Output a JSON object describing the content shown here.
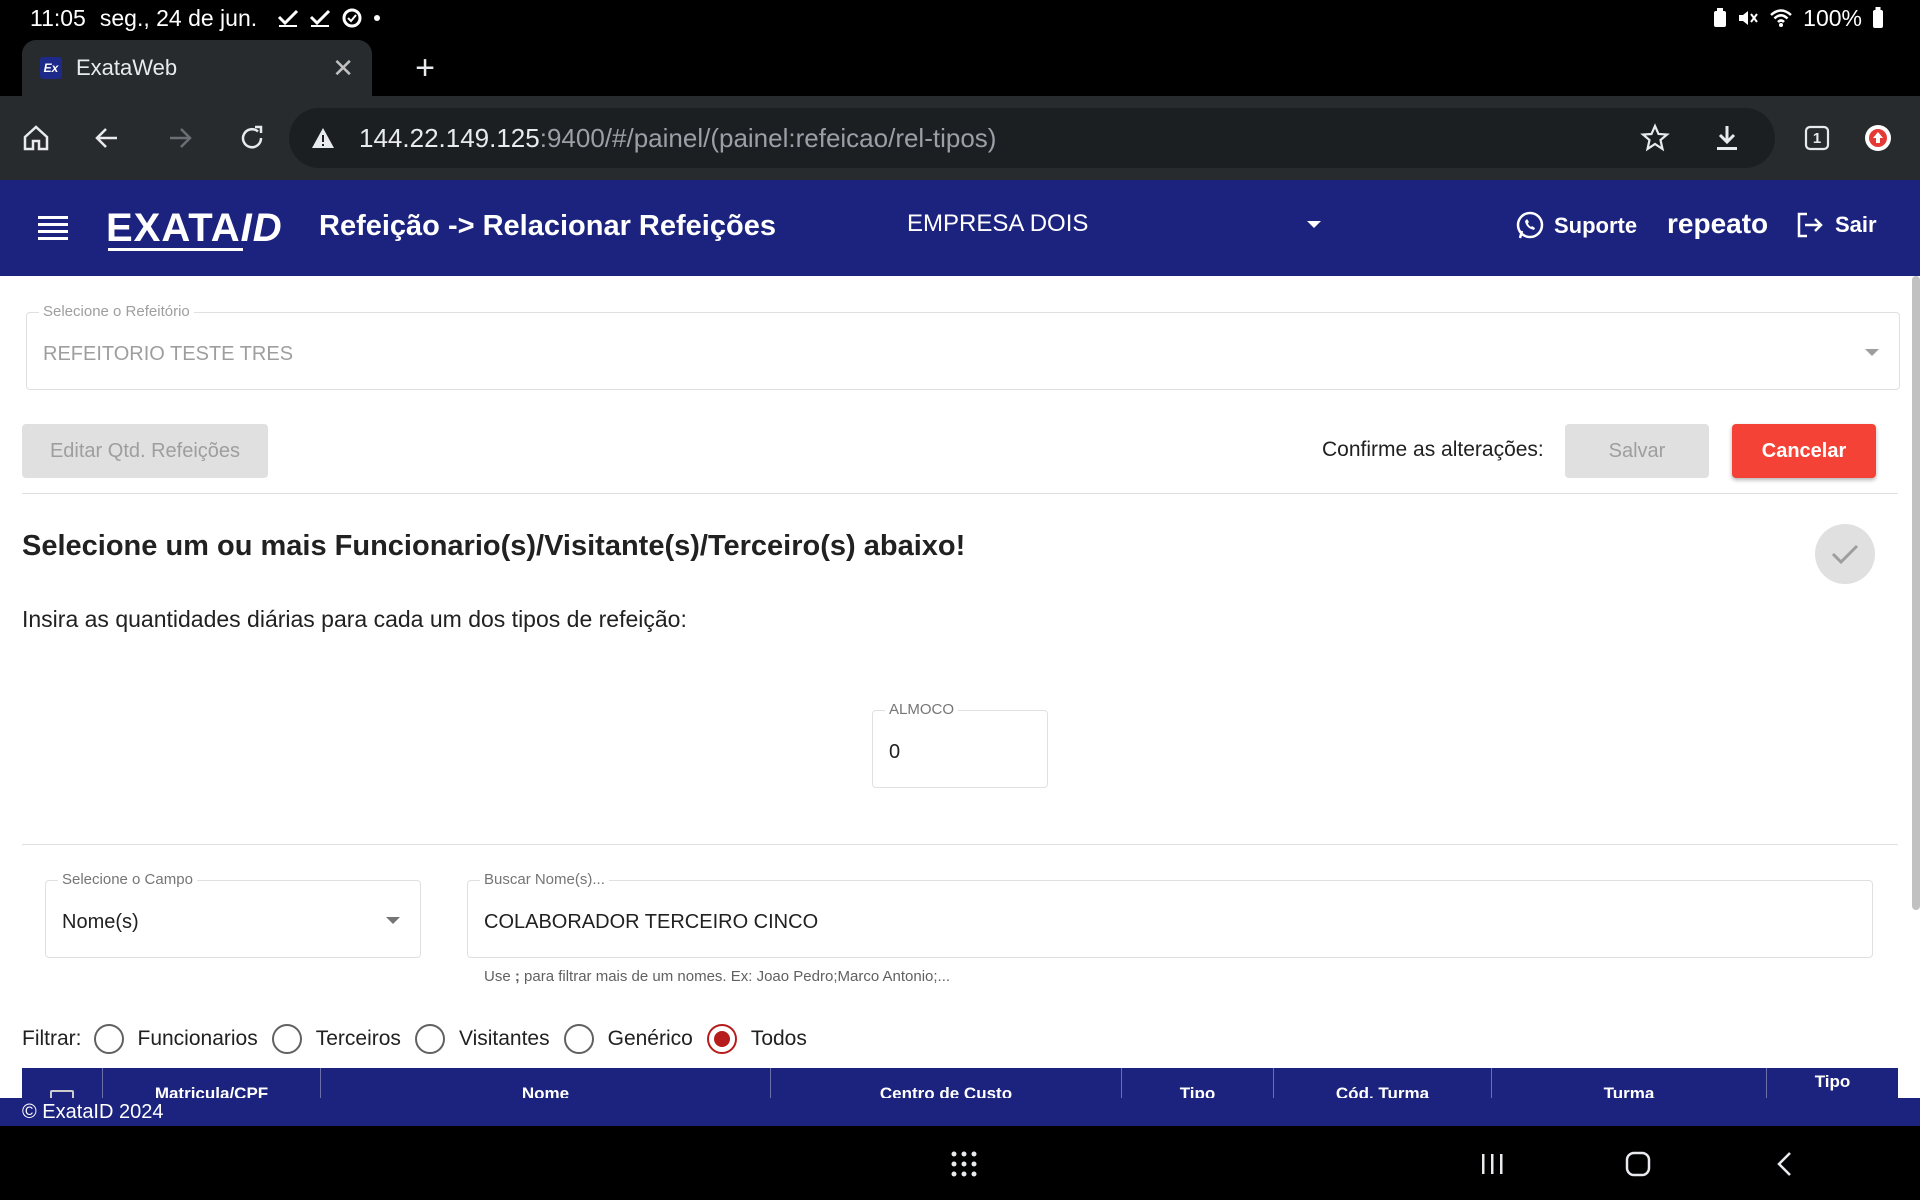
{
  "status_bar": {
    "time": "11:05",
    "date": "seg., 24 de jun.",
    "battery": "100%"
  },
  "browser": {
    "tab_title": "ExataWeb",
    "favicon_text": "Ex",
    "url_host": "144.22.149.125",
    "url_path": ":9400/#/painel/(painel:refeicao/rel-tipos)",
    "tab_count": "1"
  },
  "header": {
    "logo_text": "EXATA",
    "logo_suffix": "ID",
    "title": "Refeição -> Relacionar Refeições",
    "company": "EMPRESA DOIS",
    "support_label": "Suporte",
    "username": "repeato",
    "logout_label": "Sair"
  },
  "form": {
    "refeitorio_label": "Selecione o Refeitório",
    "refeitorio_value": "REFEITORIO TESTE TRES",
    "edit_button": "Editar Qtd. Refeições",
    "confirm_label": "Confirme as alterações:",
    "save_button": "Salvar",
    "cancel_button": "Cancelar",
    "heading": "Selecione um ou mais Funcionario(s)/Visitante(s)/Terceiro(s) abaixo!",
    "subheading": "Insira as quantidades diárias para cada um dos tipos de refeição:",
    "almoco_label": "ALMOCO",
    "almoco_value": "0"
  },
  "search": {
    "campo_label": "Selecione o Campo",
    "campo_value": "Nome(s)",
    "buscar_label": "Buscar Nome(s)...",
    "buscar_value": "COLABORADOR TERCEIRO CINCO",
    "hint_prefix": "Use ",
    "hint_bold": ";",
    "hint_suffix": " para filtrar mais de um nomes. Ex: Joao Pedro;Marco Antonio;..."
  },
  "filter": {
    "label": "Filtrar:",
    "options": [
      "Funcionarios",
      "Terceiros",
      "Visitantes",
      "Genérico",
      "Todos"
    ],
    "selected": "Todos"
  },
  "table": {
    "columns": [
      "Matricula/CPF",
      "Nome",
      "Centro de Custo",
      "Tipo",
      "Cód. Turma",
      "Turma",
      "Tipo"
    ]
  },
  "footer": {
    "copyright": "© ExataID 2024"
  },
  "colors": {
    "primary": "#1c237e",
    "danger": "#f44336",
    "radio_selected": "#b71c1c"
  }
}
